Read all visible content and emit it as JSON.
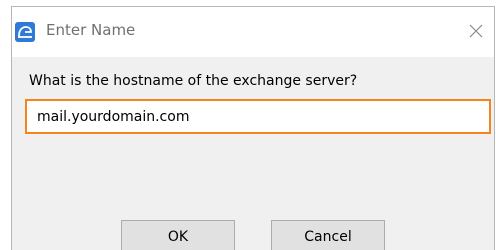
{
  "window": {
    "title": "Enter Name",
    "app_icon": "app-logo-icon",
    "close_icon": "close-icon"
  },
  "dialog": {
    "prompt": "What is the hostname of the exchange server?",
    "input_value": "mail.yourdomain.com",
    "ok_label": "OK",
    "cancel_label": "Cancel"
  },
  "colors": {
    "focus_border": "#f5831f",
    "icon_blue": "#2f7ad6",
    "title_text": "#707070",
    "button_face": "#e1e1e1",
    "dialog_background": "#f0f0f0"
  }
}
